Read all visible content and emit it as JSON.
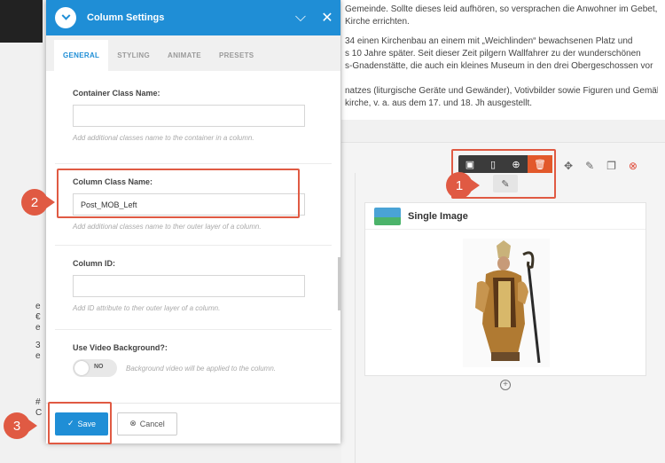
{
  "background": {
    "paragraphs": [
      "Gemeinde. Sollte dieses leid aufhören, so versprachen die Anwohner im Gebet,",
      "Kirche errichten.",
      "34 einen Kirchenbau an einem mit „Weichlinden“ bewachsenen Platz und",
      "s 10 Jahre später. Seit dieser Zeit pilgern Wallfahrer zu der wunderschönen",
      "s-Gnadenstätte, die auch ein kleines Museum in den drei Obergeschossen vor",
      "natzes (liturgische Geräte und Gewänder), Votivbilder sowie Figuren und Gemälde",
      "kirche, v. a. aus dem 17. und 18. Jh ausgestellt."
    ],
    "left_col_chars": [
      "e",
      "€",
      "e",
      "3",
      "e",
      "#",
      "C"
    ]
  },
  "dialog": {
    "title": "Column Settings",
    "tabs": [
      "GENERAL",
      "STYLING",
      "ANIMATE",
      "PRESETS"
    ],
    "fields": {
      "container_class": {
        "label": "Container Class Name:",
        "value": "",
        "help": "Add additional classes name to the container in a column."
      },
      "column_class": {
        "label": "Column Class Name:",
        "value": "Post_MOB_Left",
        "help": "Add additional classes name to ther outer layer of a column."
      },
      "column_id": {
        "label": "Column ID:",
        "value": "",
        "help": "Add ID attribute to ther outer layer of a column."
      },
      "video_bg": {
        "label": "Use Video Background?:",
        "toggle_state": "NO",
        "help": "Background video will be applied to the column."
      }
    },
    "save_label": "Save",
    "cancel_label": "Cancel"
  },
  "widget": {
    "title": "Single Image"
  },
  "badges": [
    "1",
    "2",
    "3"
  ],
  "colors": {
    "accent": "#1f8ed6",
    "annotation": "#e05a43",
    "delete": "#e2592b"
  }
}
